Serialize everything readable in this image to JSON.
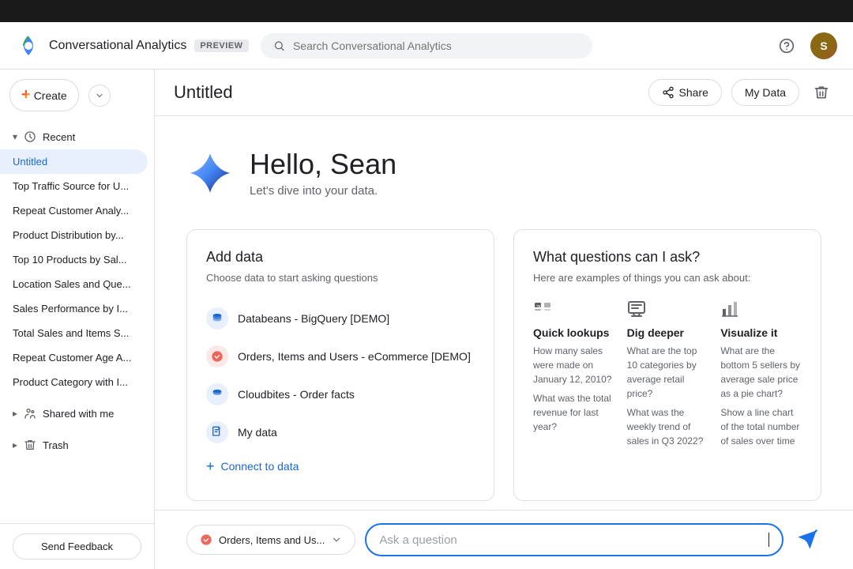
{
  "topbar": {},
  "header": {
    "app_title": "Conversational Analytics",
    "preview_label": "PREVIEW",
    "search_placeholder": "Search Conversational Analytics"
  },
  "sidebar": {
    "create_label": "Create",
    "recent_label": "Recent",
    "shared_label": "Shared with me",
    "trash_label": "Trash",
    "feedback_label": "Send Feedback",
    "recent_items": [
      "Untitled",
      "Top Traffic Source for U...",
      "Repeat Customer Analy...",
      "Product Distribution by...",
      "Top 10 Products by Sal...",
      "Location Sales and Que...",
      "Sales Performance by I...",
      "Total Sales and Items S...",
      "Repeat Customer Age A...",
      "Product Category with I..."
    ]
  },
  "page": {
    "title": "Untitled",
    "share_label": "Share",
    "my_data_label": "My Data"
  },
  "hero": {
    "greeting": "Hello, Sean",
    "subtitle": "Let's dive into your data."
  },
  "add_data": {
    "title": "Add data",
    "subtitle": "Choose data to start asking questions",
    "sources": [
      {
        "name": "Databeans - BigQuery [DEMO]",
        "icon": "db"
      },
      {
        "name": "Orders, Items and Users - eCommerce [DEMO]",
        "icon": "loop"
      },
      {
        "name": "Cloudbites - Order facts",
        "icon": "db"
      }
    ],
    "my_data_label": "My data",
    "connect_label": "Connect to data"
  },
  "questions": {
    "title": "What questions can I ask?",
    "subtitle": "Here are examples of things you can ask about:",
    "categories": [
      {
        "icon": "lookup",
        "title": "Quick lookups",
        "examples": [
          "How many sales were made on January 12, 2010?",
          "What was the total revenue for last year?"
        ]
      },
      {
        "icon": "chart",
        "title": "Dig deeper",
        "examples": [
          "What are the top 10 categories by average retail price?",
          "What was the weekly trend of sales in Q3 2022?"
        ]
      },
      {
        "icon": "bar",
        "title": "Visualize it",
        "examples": [
          "What are the bottom 5 sellers by average sale price as a pie chart?",
          "Show a line chart of the total number of sales over time"
        ]
      }
    ]
  },
  "bottombar": {
    "data_selector_label": "Orders, Items and Us...",
    "input_placeholder": "Ask a question",
    "send_icon": "send"
  }
}
